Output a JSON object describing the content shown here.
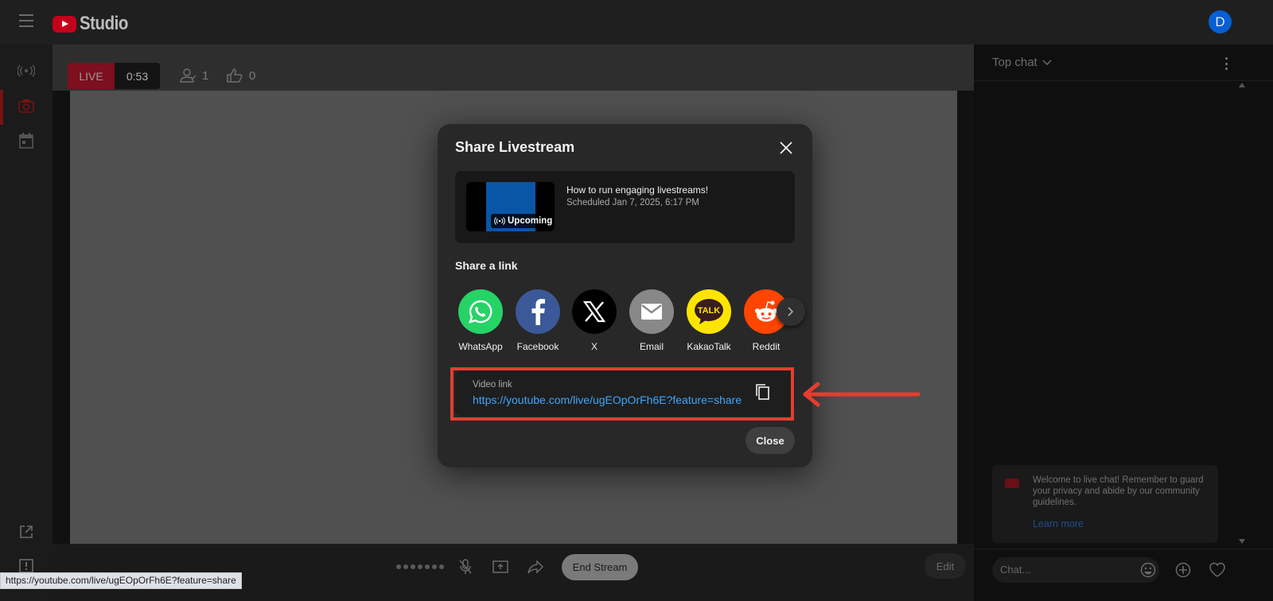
{
  "app": {
    "logo_text": "Studio",
    "avatar_letter": "D"
  },
  "live": {
    "badge": "LIVE",
    "elapsed": "0:53",
    "viewers": "1",
    "likes": "0"
  },
  "chat": {
    "title": "Top chat",
    "welcome_text": "Welcome to live chat! Remember to guard your privacy and abide by our community guidelines.",
    "learn_more": "Learn more",
    "input_placeholder": "Chat..."
  },
  "controls": {
    "end_stream": "End Stream",
    "edit": "Edit"
  },
  "modal": {
    "title": "Share Livestream",
    "video": {
      "title": "How to run engaging livestreams!",
      "scheduled": "Scheduled Jan 7, 2025, 6:17 PM",
      "badge": "Upcoming"
    },
    "share_label": "Share a link",
    "targets": [
      {
        "name": "WhatsApp",
        "color": "#25d366",
        "icon": "whatsapp-icon"
      },
      {
        "name": "Facebook",
        "color": "#3b5998",
        "icon": "facebook-icon"
      },
      {
        "name": "X",
        "color": "#000000",
        "icon": "x-icon"
      },
      {
        "name": "Email",
        "color": "#888888",
        "icon": "email-icon"
      },
      {
        "name": "KakaoTalk",
        "color": "#fee500",
        "icon": "kakaotalk-icon"
      },
      {
        "name": "Reddit",
        "color": "#ff4500",
        "icon": "reddit-icon"
      }
    ],
    "link_label": "Video link",
    "link_url": "https://youtube.com/live/ugEOpOrFh6E?feature=share",
    "close": "Close"
  },
  "status_bar": {
    "url": "https://youtube.com/live/ugEOpOrFh6E?feature=share"
  },
  "colors": {
    "annotation": "#e43d30",
    "link": "#3ea6ff",
    "live": "#cc0000"
  }
}
